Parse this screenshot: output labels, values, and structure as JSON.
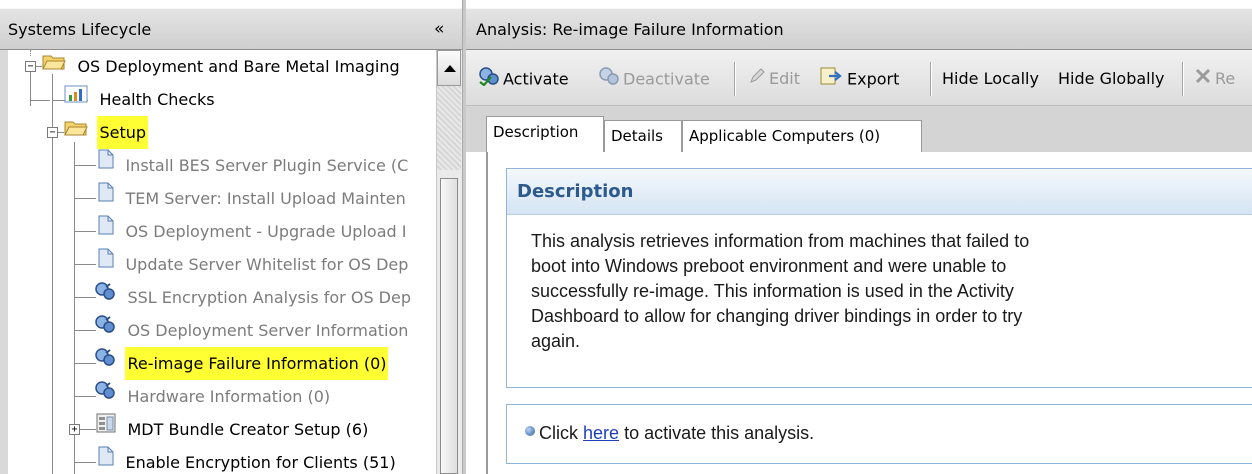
{
  "left_panel": {
    "title": "Systems Lifecycle",
    "collapse_label": "«"
  },
  "tree": {
    "root": {
      "label": "OS Deployment and Bare Metal Imaging",
      "expanded": true
    },
    "items": [
      {
        "label": "Health Checks",
        "icon": "chart-icon",
        "muted": false
      },
      {
        "label": "Setup",
        "icon": "folder-icon",
        "highlighted": true,
        "expanded": true
      },
      {
        "label": "Install BES Server Plugin Service (C",
        "icon": "document-icon",
        "muted": true
      },
      {
        "label": "TEM Server: Install Upload Mainten",
        "icon": "document-icon",
        "muted": true
      },
      {
        "label": "OS Deployment - Upgrade Upload I",
        "icon": "document-icon",
        "muted": true
      },
      {
        "label": "Update Server Whitelist for OS Dep",
        "icon": "document-icon",
        "muted": true
      },
      {
        "label": "SSL Encryption Analysis for OS Dep",
        "icon": "analysis-icon",
        "muted": true
      },
      {
        "label": "OS Deployment Server Information",
        "icon": "analysis-icon",
        "muted": true
      },
      {
        "label": "Re-image Failure Information (0)",
        "icon": "analysis-icon",
        "muted": false,
        "highlighted": true
      },
      {
        "label": "Hardware Information (0)",
        "icon": "analysis-icon",
        "muted": true
      },
      {
        "label": "MDT Bundle Creator Setup (6)",
        "icon": "dashboard-icon",
        "muted": false
      },
      {
        "label": "Enable Encryption for Clients (51)",
        "icon": "document-icon",
        "muted": false
      }
    ]
  },
  "right_panel": {
    "title": "Analysis: Re-image Failure Information"
  },
  "toolbar": {
    "activate": "Activate",
    "deactivate": "Deactivate",
    "edit": "Edit",
    "export": "Export",
    "hide_locally": "Hide Locally",
    "hide_globally": "Hide Globally",
    "remove": "Re"
  },
  "tabs": [
    {
      "label": "Description",
      "active": true
    },
    {
      "label": "Details",
      "active": false
    },
    {
      "label": "Applicable Computers (0)",
      "active": false
    }
  ],
  "description": {
    "heading": "Description",
    "lines": [
      "This analysis retrieves information from machines that failed to",
      "boot into Windows preboot environment and were unable to",
      "successfully re-image. This information is used in the Activity",
      "Dashboard to allow for changing driver bindings in order to try",
      "again."
    ]
  },
  "action": {
    "prefix": "Click",
    "link": "here",
    "suffix": "to activate this analysis."
  },
  "colors": {
    "highlight": "#ffff33",
    "link": "#1f3fb8",
    "desc_heading": "#2d5a8c",
    "box_border": "#8fb4d8"
  }
}
